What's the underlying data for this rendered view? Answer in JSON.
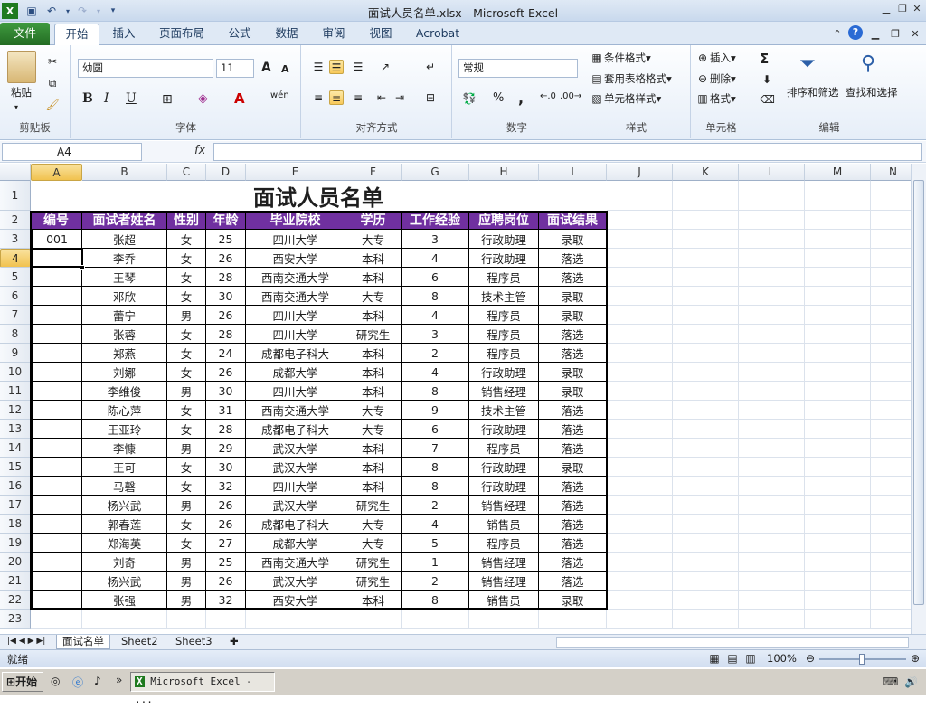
{
  "window": {
    "title": "面试人员名单.xlsx  -  Microsoft Excel",
    "qat_icons": [
      "excel-app-icon",
      "save-icon",
      "undo-icon",
      "redo-icon",
      "customize-qat-icon"
    ],
    "controls": [
      "▁",
      "❐",
      "✕"
    ]
  },
  "tabs": {
    "file": "文件",
    "home": "开始",
    "insert": "插入",
    "page_layout": "页面布局",
    "formulas": "公式",
    "data": "数据",
    "review": "审阅",
    "view": "视图",
    "acrobat": "Acrobat"
  },
  "ribbon": {
    "clipboard": {
      "paste": "粘贴",
      "label": "剪贴板"
    },
    "font": {
      "name": "幼圆",
      "size": "11",
      "label": "字体",
      "bold": "B",
      "italic": "I",
      "underline": "U",
      "grow": "A",
      "shrink": "A",
      "pinyin": "wén"
    },
    "align": {
      "label": "对齐方式"
    },
    "number": {
      "format": "常规",
      "label": "数字",
      "percent": "%",
      "comma": ","
    },
    "styles": {
      "cond": "条件格式",
      "table": "套用表格格式",
      "cell": "单元格样式",
      "label": "样式"
    },
    "cells": {
      "insert": "插入",
      "delete": "删除",
      "format": "格式",
      "label": "单元格"
    },
    "editing": {
      "sum": "Σ",
      "sort": "排序和筛选",
      "find": "查找和选择",
      "label": "编辑"
    }
  },
  "formula_bar": {
    "name_box": "A4",
    "fx": "fx",
    "value": ""
  },
  "sheet": {
    "columns": [
      "A",
      "B",
      "C",
      "D",
      "E",
      "F",
      "G",
      "H",
      "I",
      "J",
      "K",
      "L",
      "M",
      "N"
    ],
    "selected_col": "A",
    "selected_row": "4",
    "rows": [
      "1",
      "2",
      "3",
      "4",
      "5",
      "6",
      "7",
      "8",
      "9",
      "10",
      "11",
      "12",
      "13",
      "14",
      "15",
      "16",
      "17",
      "18",
      "19",
      "20",
      "21",
      "22",
      "23"
    ],
    "title": "面试人员名单",
    "headers": [
      "编号",
      "面试者姓名",
      "性别",
      "年龄",
      "毕业院校",
      "学历",
      "工作经验",
      "应聘岗位",
      "面试结果"
    ],
    "data": [
      [
        "001",
        "张超",
        "女",
        "25",
        "四川大学",
        "大专",
        "3",
        "行政助理",
        "录取"
      ],
      [
        "",
        "李乔",
        "女",
        "26",
        "西安大学",
        "本科",
        "4",
        "行政助理",
        "落选"
      ],
      [
        "",
        "王琴",
        "女",
        "28",
        "西南交通大学",
        "本科",
        "6",
        "程序员",
        "落选"
      ],
      [
        "",
        "邓欣",
        "女",
        "30",
        "西南交通大学",
        "大专",
        "8",
        "技术主管",
        "录取"
      ],
      [
        "",
        "蕾宁",
        "男",
        "26",
        "四川大学",
        "本科",
        "4",
        "程序员",
        "录取"
      ],
      [
        "",
        "张蓉",
        "女",
        "28",
        "四川大学",
        "研究生",
        "3",
        "程序员",
        "落选"
      ],
      [
        "",
        "郑燕",
        "女",
        "24",
        "成都电子科大",
        "本科",
        "2",
        "程序员",
        "落选"
      ],
      [
        "",
        "刘娜",
        "女",
        "26",
        "成都大学",
        "本科",
        "4",
        "行政助理",
        "录取"
      ],
      [
        "",
        "李维俊",
        "男",
        "30",
        "四川大学",
        "本科",
        "8",
        "销售经理",
        "录取"
      ],
      [
        "",
        "陈心萍",
        "女",
        "31",
        "西南交通大学",
        "大专",
        "9",
        "技术主管",
        "落选"
      ],
      [
        "",
        "王亚玲",
        "女",
        "28",
        "成都电子科大",
        "大专",
        "6",
        "行政助理",
        "落选"
      ],
      [
        "",
        "李慷",
        "男",
        "29",
        "武汉大学",
        "本科",
        "7",
        "程序员",
        "落选"
      ],
      [
        "",
        "王可",
        "女",
        "30",
        "武汉大学",
        "本科",
        "8",
        "行政助理",
        "录取"
      ],
      [
        "",
        "马磬",
        "女",
        "32",
        "四川大学",
        "本科",
        "8",
        "行政助理",
        "落选"
      ],
      [
        "",
        "杨兴武",
        "男",
        "26",
        "武汉大学",
        "研究生",
        "2",
        "销售经理",
        "落选"
      ],
      [
        "",
        "郭春莲",
        "女",
        "26",
        "成都电子科大",
        "大专",
        "4",
        "销售员",
        "落选"
      ],
      [
        "",
        "郑海英",
        "女",
        "27",
        "成都大学",
        "大专",
        "5",
        "程序员",
        "落选"
      ],
      [
        "",
        "刘奇",
        "男",
        "25",
        "西南交通大学",
        "研究生",
        "1",
        "销售经理",
        "落选"
      ],
      [
        "",
        "杨兴武",
        "男",
        "26",
        "武汉大学",
        "研究生",
        "2",
        "销售经理",
        "落选"
      ],
      [
        "",
        "张强",
        "男",
        "32",
        "西安大学",
        "本科",
        "8",
        "销售员",
        "录取"
      ]
    ]
  },
  "sheet_tabs": [
    "面试名单",
    "Sheet2",
    "Sheet3"
  ],
  "status": {
    "ready": "就绪",
    "zoom": "100%"
  },
  "taskbar": {
    "start": "开始",
    "task": "Microsoft Excel - ..."
  }
}
